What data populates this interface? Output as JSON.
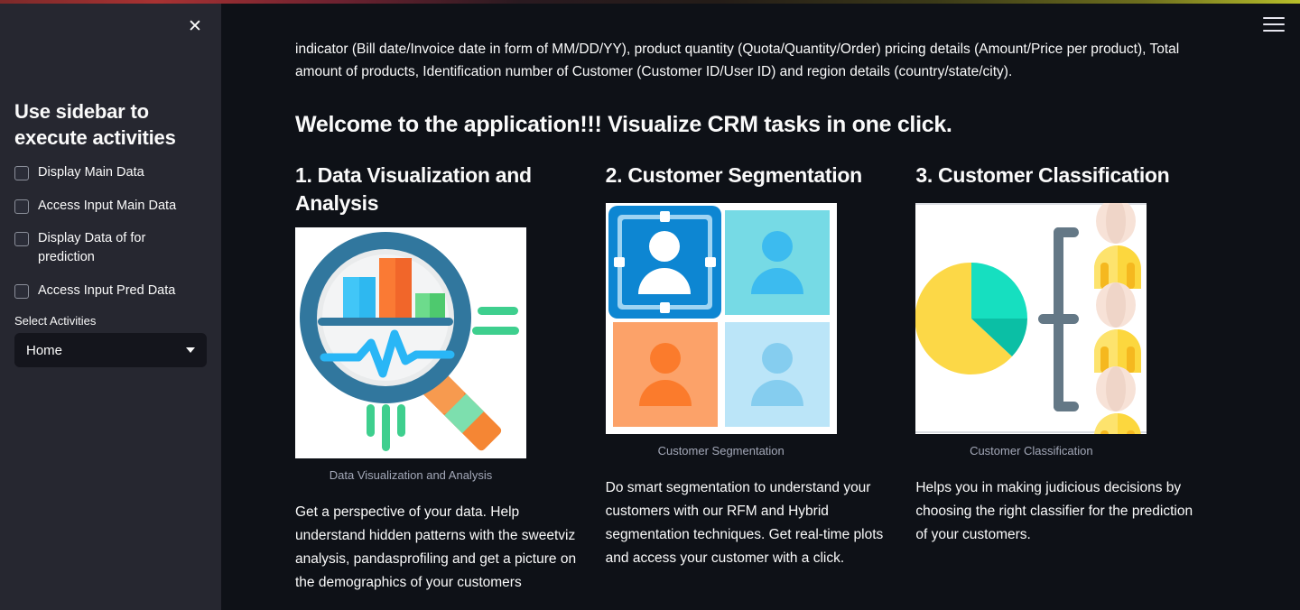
{
  "top_accent": {
    "from": "#a83232",
    "to": "#b8bf2a"
  },
  "sidebar": {
    "close_icon_label": "✕",
    "title": "Use sidebar to execute activities",
    "checkboxes": [
      {
        "label": "Display Main Data",
        "checked": false
      },
      {
        "label": "Access Input Main Data",
        "checked": false
      },
      {
        "label": "Display Data of for prediction",
        "checked": false
      },
      {
        "label": "Access Input Pred Data",
        "checked": false
      }
    ],
    "select": {
      "label": "Select Activities",
      "value": "Home",
      "options": [
        "Home"
      ]
    }
  },
  "header": {
    "menu_icon": "hamburger-menu"
  },
  "main": {
    "intro_paragraph": "indicator (Bill date/Invoice date in form of MM/DD/YY), product quantity (Quota/Quantity/Order) pricing details (Amount/Price per product), Total amount of products, Identification number of Customer (Customer ID/User ID) and region details (country/state/city).",
    "welcome_heading": "Welcome to the application!!! Visualize CRM tasks in one click.",
    "columns": [
      {
        "heading": "1. Data Visualization and Analysis",
        "image_name": "data-visualization-magnifier-chart",
        "caption": "Data Visualization and Analysis",
        "body": "Get a perspective of your data. Help understand hidden patterns with the sweetviz analysis, pandasprofiling and get a picture on the demographics of your customers"
      },
      {
        "heading": "2. Customer Segmentation",
        "image_name": "customer-segmentation-quadrant",
        "caption": "Customer Segmentation",
        "body": "Do smart segmentation to understand your customers with our RFM and Hybrid segmentation techniques. Get real-time plots and access your customer with a click."
      },
      {
        "heading": "3. Customer Classification",
        "image_name": "customer-classification-pie-people",
        "caption": "Customer Classification",
        "body": "Helps you in making judicious decisions by choosing the right classifier for the prediction of your customers."
      }
    ]
  },
  "colors": {
    "background": "#0e1117",
    "sidebar_background": "#262730",
    "text": "#fafafa",
    "caption_text": "#a3a8b8"
  }
}
